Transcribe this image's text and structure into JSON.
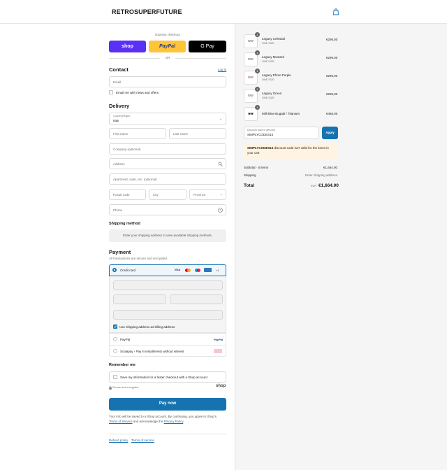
{
  "header": {
    "brand": "RETROSUPERFUTURE",
    "cart_icon": "shopping-bag-icon"
  },
  "express": {
    "label": "Express checkout",
    "or": "OR",
    "shop_label": "shop",
    "paypal_label": "PayPal",
    "gpay_label": "G Pay",
    "colors": {
      "shop": "#5a31f4",
      "paypal": "#ffc439",
      "gpay": "#000000"
    }
  },
  "contact": {
    "title": "Contact",
    "login": "Log in",
    "email_placeholder": "Email",
    "newsletter": "Email me with news and offers"
  },
  "delivery": {
    "title": "Delivery",
    "country_label": "Country/Region",
    "country_value": "Italy",
    "first_name": "First name",
    "last_name": "Last name",
    "company": "Company (optional)",
    "address": "Address",
    "apartment": "Apartment, suite, etc. (optional)",
    "postal": "Postal code",
    "city": "City",
    "province": "Province",
    "phone": "Phone"
  },
  "shipping": {
    "title": "Shipping method",
    "note": "Enter your shipping address to view available shipping methods."
  },
  "payment": {
    "title": "Payment",
    "subtitle": "All transactions are secure and encrypted.",
    "credit_card": "Credit card",
    "card_more": "+1",
    "billing_same": "Use shipping address as billing address",
    "paypal": "PayPal",
    "paypal_logo": "PayPal",
    "scalapay": "Scalapay - Pay in installments without interest",
    "accent": "#1773b0"
  },
  "remember": {
    "title": "Remember me",
    "save_info": "Save my information for a faster checkout with a Shop account",
    "secure": "Secure and encrypted",
    "shop_logo": "shop"
  },
  "pay_now": {
    "label": "Pay now",
    "color": "#1773b0"
  },
  "terms": {
    "line1": "Your info will be saved to a Shop account. By continuing, you agree to Shop's",
    "tos": "Terms of Service",
    "mid": "and acknowledge the",
    "privacy": "Privacy Policy",
    "end": "."
  },
  "footer": {
    "refund": "Refund policy",
    "terms": "Terms of service"
  },
  "cart": {
    "items": [
      {
        "name": "Legacy Celestial",
        "size": "ONE SIZE",
        "price": "€299,00",
        "qty": "1"
      },
      {
        "name": "Legacy Mustard",
        "size": "ONE SIZE",
        "price": "€299,00",
        "qty": "1"
      },
      {
        "name": "Legacy Photo Purple",
        "size": "ONE SIZE",
        "price": "€299,00",
        "qty": "1"
      },
      {
        "name": "Legacy Green",
        "size": "ONE SIZE",
        "price": "€299,00",
        "qty": "1"
      },
      {
        "name": "Milli Blue Bugatti / Titanium",
        "size": "",
        "price": "€468,00",
        "qty": "1"
      }
    ],
    "discount_label": "Discount code or gift card",
    "discount_value": "SIMPLYCODES15",
    "apply": "Apply",
    "error_code": "SIMPLYCODES15",
    "error_text": "discount code isn't valid for the items in your cart",
    "subtotal_label": "Subtotal · 5 items",
    "subtotal_value": "€1,664.00",
    "shipping_label": "Shipping",
    "shipping_value": "Enter shipping address",
    "total_label": "Total",
    "currency": "EUR",
    "total_value": "€1,664.00"
  }
}
